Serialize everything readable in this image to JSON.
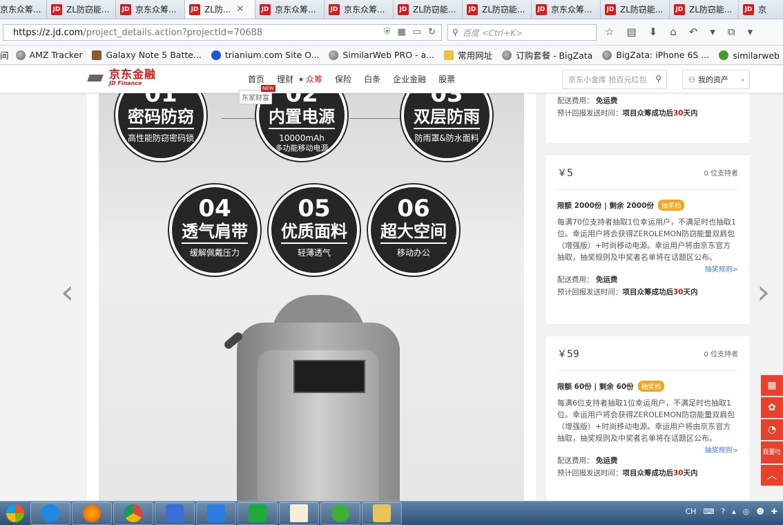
{
  "browser": {
    "tabs": [
      {
        "label": "京东众筹..."
      },
      {
        "label": "ZL防窃能..."
      },
      {
        "label": "京东众筹..."
      },
      {
        "label": "ZL防..."
      },
      {
        "label": "京东众筹..."
      },
      {
        "label": "京东众筹..."
      },
      {
        "label": "ZL防窃能..."
      },
      {
        "label": "ZL防窃能..."
      },
      {
        "label": "京东众筹..."
      },
      {
        "label": "ZL防窃能..."
      },
      {
        "label": "ZL防窃能..."
      },
      {
        "label": "京"
      }
    ],
    "url_host": "https://z.jd.com",
    "url_path": "/project_details.action?projectId=70688",
    "search_placeholder": "百度 <Ctrl+K>",
    "bookmarks": [
      {
        "label": "AMZ Tracker",
        "icon": "globe"
      },
      {
        "label": "Galaxy Note 5 Batte...",
        "icon": "moose"
      },
      {
        "label": "trianium.com Site O...",
        "icon": "a"
      },
      {
        "label": "SimilarWeb PRO - a...",
        "icon": "globe"
      },
      {
        "label": "常用网址",
        "icon": "folder"
      },
      {
        "label": "订购套餐 - BigZata",
        "icon": "globe"
      },
      {
        "label": "BigZata: iPhone 6S ...",
        "icon": "globe"
      },
      {
        "label": "similarweb（付费版...",
        "icon": "w"
      }
    ]
  },
  "jd": {
    "logo_name": "京东金融",
    "logo_sub": "JD Finance",
    "menu": [
      {
        "label": "首页"
      },
      {
        "label": "理财"
      },
      {
        "label": "众筹"
      },
      {
        "label": "保险"
      },
      {
        "label": "白条"
      },
      {
        "label": "企业金融"
      },
      {
        "label": "股票"
      }
    ],
    "new_flag": "NEW",
    "new_sublabel": "东家财富",
    "search_placeholder": "京东小金库 抢百元红包",
    "my_assets": "我的资产"
  },
  "hero": {
    "features": [
      {
        "num": "01",
        "title": "密码防窃",
        "desc": "高性能防窃密码锁",
        "desc2": ""
      },
      {
        "num": "02",
        "title": "内置电源",
        "desc": "10000mAh",
        "desc2": "多功能移动电源"
      },
      {
        "num": "03",
        "title": "双层防雨",
        "desc": "防雨罩&防水面料",
        "desc2": ""
      },
      {
        "num": "04",
        "title": "透气肩带",
        "desc": "缓解佩戴压力",
        "desc2": ""
      },
      {
        "num": "05",
        "title": "优质面料",
        "desc": "轻薄透气",
        "desc2": ""
      },
      {
        "num": "06",
        "title": "超大空间",
        "desc": "移动办公",
        "desc2": ""
      }
    ]
  },
  "cards": [
    {
      "shipping_label": "配送费用：",
      "shipping_value": "免运费",
      "time_label": "预计回报发送时间：",
      "time_value_pre": "项目众筹成功后",
      "time_value_num": "30",
      "time_value_post": "天内"
    },
    {
      "price": "￥5",
      "supporters_num": "0",
      "supporters_label": "位支持者",
      "quota": "限额 2000份 | 剩余 2000份",
      "tag": "抽奖档",
      "desc": "每满70位支持者抽取1位幸运用户，不满足时也抽取1位。幸运用户将会获得ZEROLEMON防窃能量双肩包（增强版）+时尚移动电源。幸运用户将由京东官方抽取，抽奖规则及中奖者名单将在话题区公布。",
      "rules": "抽奖规则>",
      "shipping_label": "配送费用：",
      "shipping_value": "免运费",
      "time_label": "预计回报发送时间：",
      "time_value_pre": "项目众筹成功后",
      "time_value_num": "30",
      "time_value_post": "天内"
    },
    {
      "price": "￥59",
      "supporters_num": "0",
      "supporters_label": "位支持者",
      "quota": "限额 60份 | 剩余 60份",
      "tag": "抽奖档",
      "desc": "每满6位支持者抽取1位幸运用户，不满足时也抽取1位。幸运用户将会获得ZEROLEMON防窃能量双肩包（增强版）+时尚移动电源。幸运用户将由京东官方抽取，抽奖规则及中奖者名单将在话题区公布。",
      "rules": "抽奖规则>",
      "shipping_label": "配送费用：",
      "shipping_value": "免运费",
      "time_label": "预计回报发送时间：",
      "time_value_pre": "项目众筹成功后",
      "time_value_num": "30",
      "time_value_post": "天内"
    }
  ],
  "side_buttons": {
    "feedback": "我要吐"
  },
  "tray": {
    "lang": "CH"
  }
}
